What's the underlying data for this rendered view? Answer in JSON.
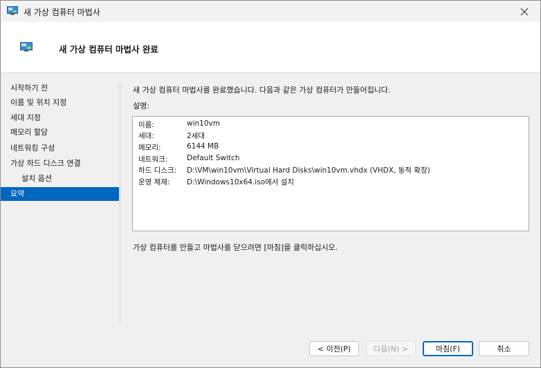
{
  "window": {
    "title": "새 가상 컴퓨터 마법사"
  },
  "header": {
    "title": "새 가상 컴퓨터 마법사 완료"
  },
  "sidebar": {
    "items": [
      {
        "label": "시작하기 전"
      },
      {
        "label": "이름 및 위치 지정"
      },
      {
        "label": "세대 지정"
      },
      {
        "label": "메모리 할당"
      },
      {
        "label": "네트워킹 구성"
      },
      {
        "label": "가상 하드 디스크 연결"
      },
      {
        "label": "설치 옵션"
      },
      {
        "label": "요약"
      }
    ]
  },
  "main": {
    "intro": "새 가상 컴퓨터 마법사를 완료했습니다. 다음과 같은 가상 컴퓨터가 만들어집니다.",
    "description_label": "설명:",
    "summary": [
      {
        "key": "이름:",
        "value": "win10vm"
      },
      {
        "key": "세대:",
        "value": "2세대"
      },
      {
        "key": "메모리:",
        "value": "6144 MB"
      },
      {
        "key": "네트워크:",
        "value": "Default Switch"
      },
      {
        "key": "하드 디스크:",
        "value": "D:\\VM\\win10vm\\Virtual Hard Disks\\win10vm.vhdx (VHDX, 동적 확장)"
      },
      {
        "key": "운영 체제:",
        "value": "D:\\Windows10x64.iso에서 설치"
      }
    ],
    "finish_instruction": "가상 컴퓨터를 만들고 마법사를 닫으려면 [마침]을 클릭하십시오."
  },
  "buttons": {
    "previous": "< 이전(P)",
    "next": "다음(N) >",
    "finish": "마침(F)",
    "cancel": "취소"
  },
  "colors": {
    "accent": "#0067c0",
    "window_bg": "#f0f0f0",
    "header_bg": "#ffffff"
  }
}
